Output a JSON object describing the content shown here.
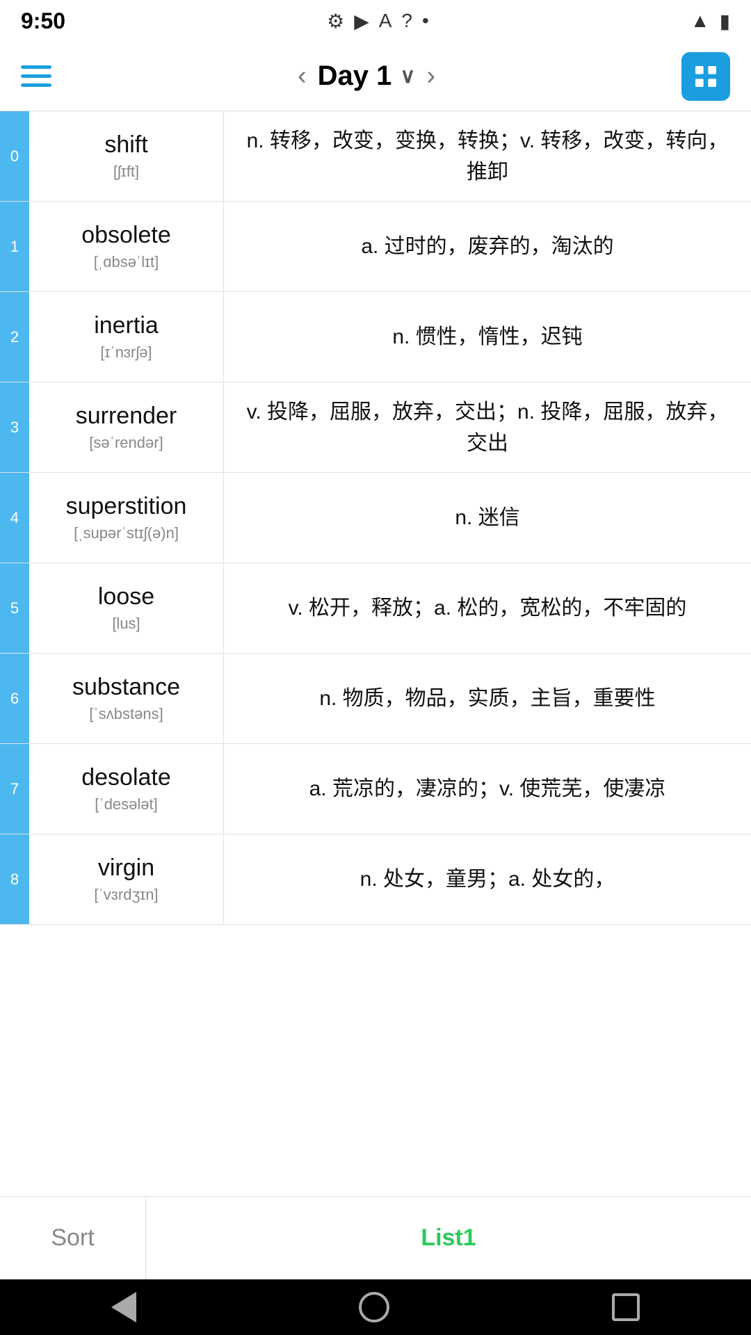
{
  "status": {
    "time": "9:50",
    "icons": [
      "⚙",
      "▶",
      "A",
      "?",
      "•"
    ],
    "signal": "▲",
    "battery": "🔋"
  },
  "nav": {
    "title": "Day 1",
    "prev_label": "‹",
    "next_label": "›",
    "grid_label": "grid"
  },
  "words": [
    {
      "index": "0",
      "english": "shift",
      "phonetic": "[ʃɪft]",
      "definition": "n. 转移，改变，变换，转换；v. 转移，改变，转向，推卸"
    },
    {
      "index": "1",
      "english": "obsolete",
      "phonetic": "[ˌɑbsəˈlɪt]",
      "definition": "a. 过时的，废弃的，淘汰的"
    },
    {
      "index": "2",
      "english": "inertia",
      "phonetic": "[ɪˈnɜrʃə]",
      "definition": "n. 惯性，惰性，迟钝"
    },
    {
      "index": "3",
      "english": "surrender",
      "phonetic": "[səˈrendər]",
      "definition": "v. 投降，屈服，放弃，交出；n. 投降，屈服，放弃，交出"
    },
    {
      "index": "4",
      "english": "superstition",
      "phonetic": "[ˌsupərˈstɪʃ(ə)n]",
      "definition": "n. 迷信"
    },
    {
      "index": "5",
      "english": "loose",
      "phonetic": "[lus]",
      "definition": "v. 松开，释放；a. 松的，宽松的，不牢固的"
    },
    {
      "index": "6",
      "english": "substance",
      "phonetic": "[ˈsʌbstəns]",
      "definition": "n. 物质，物品，实质，主旨，重要性"
    },
    {
      "index": "7",
      "english": "desolate",
      "phonetic": "[ˈdesələt]",
      "definition": "a. 荒凉的，凄凉的；v. 使荒芜，使凄凉"
    },
    {
      "index": "8",
      "english": "virgin",
      "phonetic": "[ˈvɜrdʒɪn]",
      "definition": "n. 处女，童男；a. 处女的，"
    }
  ],
  "bottom_tabs": {
    "sort_label": "Sort",
    "list1_label": "List1"
  },
  "android_nav": {
    "back": "back",
    "home": "home",
    "recents": "recents"
  }
}
